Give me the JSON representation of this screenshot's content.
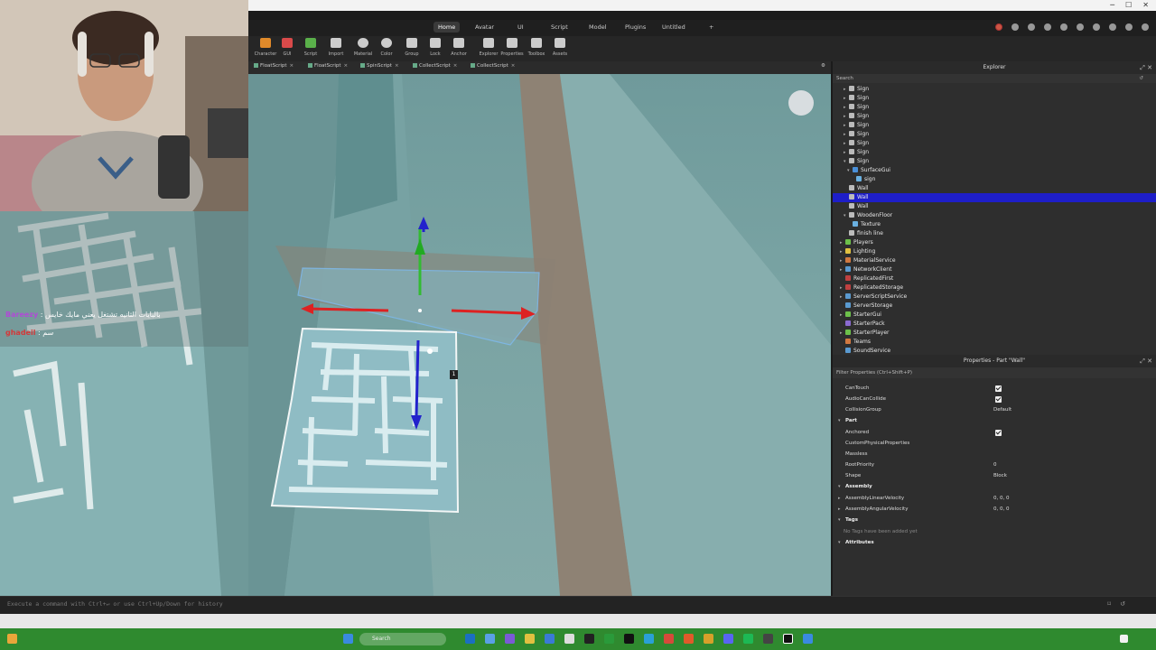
{
  "ribbon": {
    "tabs": [
      "Home",
      "Avatar",
      "UI",
      "Script",
      "Model",
      "Plugins",
      "Untitled"
    ],
    "active_tab": "Home",
    "add_tab": "+",
    "tools": [
      "Character",
      "GUI",
      "Script",
      "Import",
      "Material",
      "Color",
      "Group",
      "Lock",
      "Anchor",
      "Explorer",
      "Properties",
      "Toolbox",
      "Assets"
    ]
  },
  "doc_tabs": [
    {
      "label": "FloatScript",
      "close": "×"
    },
    {
      "label": "FloatScript",
      "close": "×"
    },
    {
      "label": "SpinScript",
      "close": "×"
    },
    {
      "label": "CollectScript",
      "close": "×"
    },
    {
      "label": "CollectScript",
      "close": "×"
    }
  ],
  "chat": {
    "messages": [
      {
        "user": "Bareezy",
        "text": "بالبايات الثانيه تشتغل يعني مايك خايس"
      },
      {
        "user": "ghadeil",
        "text": "سم"
      }
    ]
  },
  "viewport": {
    "badge": "1"
  },
  "explorer": {
    "title": "Explorer",
    "search_placeholder": "Search",
    "items": [
      {
        "label": "Sign",
        "indent": 2,
        "arrow": "▸",
        "color": "#bbbbbb"
      },
      {
        "label": "Sign",
        "indent": 2,
        "arrow": "▸",
        "color": "#bbbbbb"
      },
      {
        "label": "Sign",
        "indent": 2,
        "arrow": "▸",
        "color": "#bbbbbb"
      },
      {
        "label": "Sign",
        "indent": 2,
        "arrow": "▸",
        "color": "#bbbbbb"
      },
      {
        "label": "Sign",
        "indent": 2,
        "arrow": "▸",
        "color": "#bbbbbb"
      },
      {
        "label": "Sign",
        "indent": 2,
        "arrow": "▸",
        "color": "#bbbbbb"
      },
      {
        "label": "Sign",
        "indent": 2,
        "arrow": "▸",
        "color": "#bbbbbb"
      },
      {
        "label": "Sign",
        "indent": 2,
        "arrow": "▸",
        "color": "#bbbbbb"
      },
      {
        "label": "Sign",
        "indent": 2,
        "arrow": "▾",
        "color": "#bbbbbb"
      },
      {
        "label": "SurfaceGui",
        "indent": 3,
        "arrow": "▾",
        "color": "#4a90d9"
      },
      {
        "label": "sign",
        "indent": 4,
        "arrow": "",
        "color": "#6ab0e0"
      },
      {
        "label": "Wall",
        "indent": 2,
        "arrow": "",
        "color": "#bbbbbb"
      },
      {
        "label": "Wall",
        "indent": 2,
        "arrow": "",
        "color": "#bbbbbb",
        "selected": true
      },
      {
        "label": "Wall",
        "indent": 2,
        "arrow": "",
        "color": "#bbbbbb"
      },
      {
        "label": "WoodenFloor",
        "indent": 2,
        "arrow": "▾",
        "color": "#bbbbbb"
      },
      {
        "label": "Texture",
        "indent": 3,
        "arrow": "",
        "color": "#6ab0e0"
      },
      {
        "label": "finish line",
        "indent": 2,
        "arrow": "",
        "color": "#bbbbbb"
      },
      {
        "label": "Players",
        "indent": 1,
        "arrow": "▸",
        "color": "#6cc04a"
      },
      {
        "label": "Lighting",
        "indent": 1,
        "arrow": "▸",
        "color": "#e0c040"
      },
      {
        "label": "MaterialService",
        "indent": 1,
        "arrow": "▸",
        "color": "#d07840"
      },
      {
        "label": "NetworkClient",
        "indent": 1,
        "arrow": "▸",
        "color": "#5a9ad0"
      },
      {
        "label": "ReplicatedFirst",
        "indent": 1,
        "arrow": "",
        "color": "#c04040"
      },
      {
        "label": "ReplicatedStorage",
        "indent": 1,
        "arrow": "▸",
        "color": "#c04040"
      },
      {
        "label": "ServerScriptService",
        "indent": 1,
        "arrow": "▸",
        "color": "#5a9ad0"
      },
      {
        "label": "ServerStorage",
        "indent": 1,
        "arrow": "",
        "color": "#5a9ad0"
      },
      {
        "label": "StarterGui",
        "indent": 1,
        "arrow": "▸",
        "color": "#6cc04a"
      },
      {
        "label": "StarterPack",
        "indent": 1,
        "arrow": "",
        "color": "#8a6ad0"
      },
      {
        "label": "StarterPlayer",
        "indent": 1,
        "arrow": "▸",
        "color": "#6cc04a"
      },
      {
        "label": "Teams",
        "indent": 1,
        "arrow": "",
        "color": "#d07840"
      },
      {
        "label": "SoundService",
        "indent": 1,
        "arrow": "",
        "color": "#5a9ad0"
      }
    ]
  },
  "properties": {
    "title": "Properties - Part \"Wall\"",
    "filter_placeholder": "Filter Properties (Ctrl+Shift+P)",
    "rows": [
      {
        "name": "CanTouch",
        "type": "check"
      },
      {
        "name": "AudioCanCollide",
        "type": "check"
      },
      {
        "name": "CollisionGroup",
        "type": "text",
        "value": "Default"
      },
      {
        "name": "Part",
        "type": "section"
      },
      {
        "name": "Anchored",
        "type": "check"
      },
      {
        "name": "CustomPhysicalProperties",
        "type": "text",
        "value": ""
      },
      {
        "name": "Massless",
        "type": "text",
        "value": ""
      },
      {
        "name": "RootPriority",
        "type": "text",
        "value": "0"
      },
      {
        "name": "Shape",
        "type": "text",
        "value": "Block"
      },
      {
        "name": "Assembly",
        "type": "section"
      },
      {
        "name": "AssemblyLinearVelocity",
        "type": "text",
        "value": "0, 0, 0",
        "caret": "▸"
      },
      {
        "name": "AssemblyAngularVelocity",
        "type": "text",
        "value": "0, 0, 0",
        "caret": "▸"
      },
      {
        "name": "Tags",
        "type": "section"
      },
      {
        "name": "No Tags have been added yet",
        "type": "note"
      },
      {
        "name": "Attributes",
        "type": "section"
      }
    ]
  },
  "command_bar": {
    "placeholder": "Execute a command with Ctrl+↵ or use Ctrl+Up/Down for history"
  },
  "taskbar": {
    "search": "Search"
  }
}
